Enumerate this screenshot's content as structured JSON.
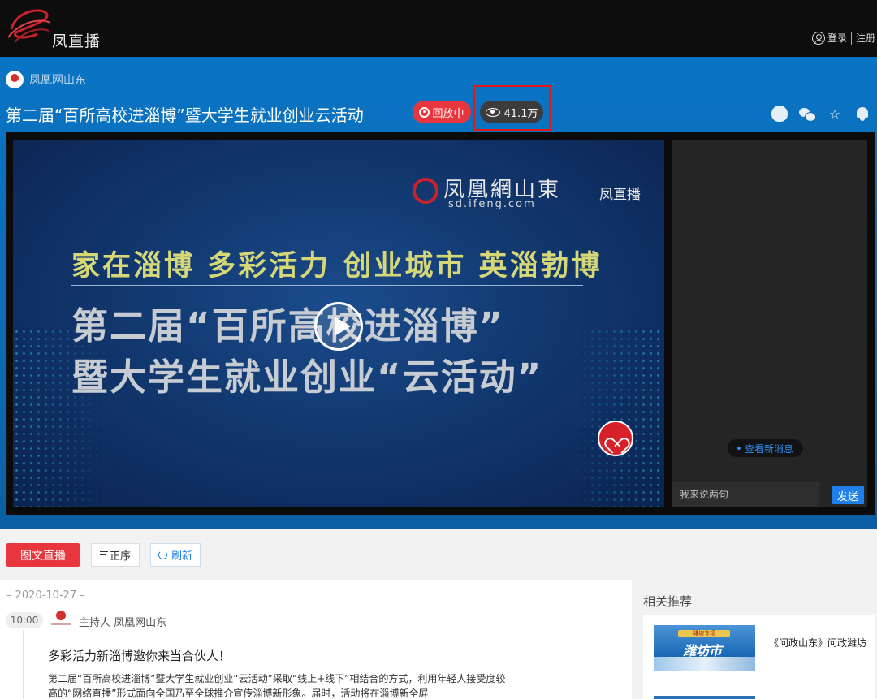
{
  "header": {
    "logo_text": "凤直播",
    "login_label": "登录",
    "register_label": "注册"
  },
  "channel": {
    "name": "凤凰网山东"
  },
  "live": {
    "title": "第二届“百所高校进淄博”暨大学生就业创业云活动",
    "status_badge": "回放中",
    "view_count": "41.1万"
  },
  "video": {
    "logo_name": "凤凰網山東",
    "logo_url": "sd.ifeng.com",
    "logo2": "凤直播",
    "slogan": "家在淄博  多彩活力  创业城市  英淄勃博",
    "headline_line1": "第二届“百所高校进淄博”",
    "headline_line2": "暨大学生就业创业“云活动”"
  },
  "chat": {
    "new_messages_label": "查看新消息",
    "input_placeholder": "我来说两句",
    "send_label": "发送"
  },
  "tabs": {
    "live_label": "图文直播",
    "order_label": "正序",
    "refresh_label": "刷新"
  },
  "feed": {
    "date": "– 2020-10-27 –",
    "time": "10:00",
    "host": "主持人 凤凰网山东",
    "post_title": "多彩活力新淄博邀你来当合伙人！",
    "post_body": "第二届“百所高校进淄博”暨大学生就业创业“云活动”采取“线上+线下”相结合的方式，利用年轻人接受度较高的“网络直播”形式面向全国乃至全球推介宣传淄博新形象。届时，活动将在淄博新全屏"
  },
  "sidebar": {
    "title": "相关推荐",
    "items": [
      {
        "thumb_banner": "潍坊专场",
        "thumb_title": "潍坊市",
        "text": "《问政山东》问政潍坊"
      }
    ]
  },
  "colors": {
    "hero_blue": "#0d6bb4",
    "accent_red": "#e8363e",
    "link_blue": "#1e80e8"
  }
}
